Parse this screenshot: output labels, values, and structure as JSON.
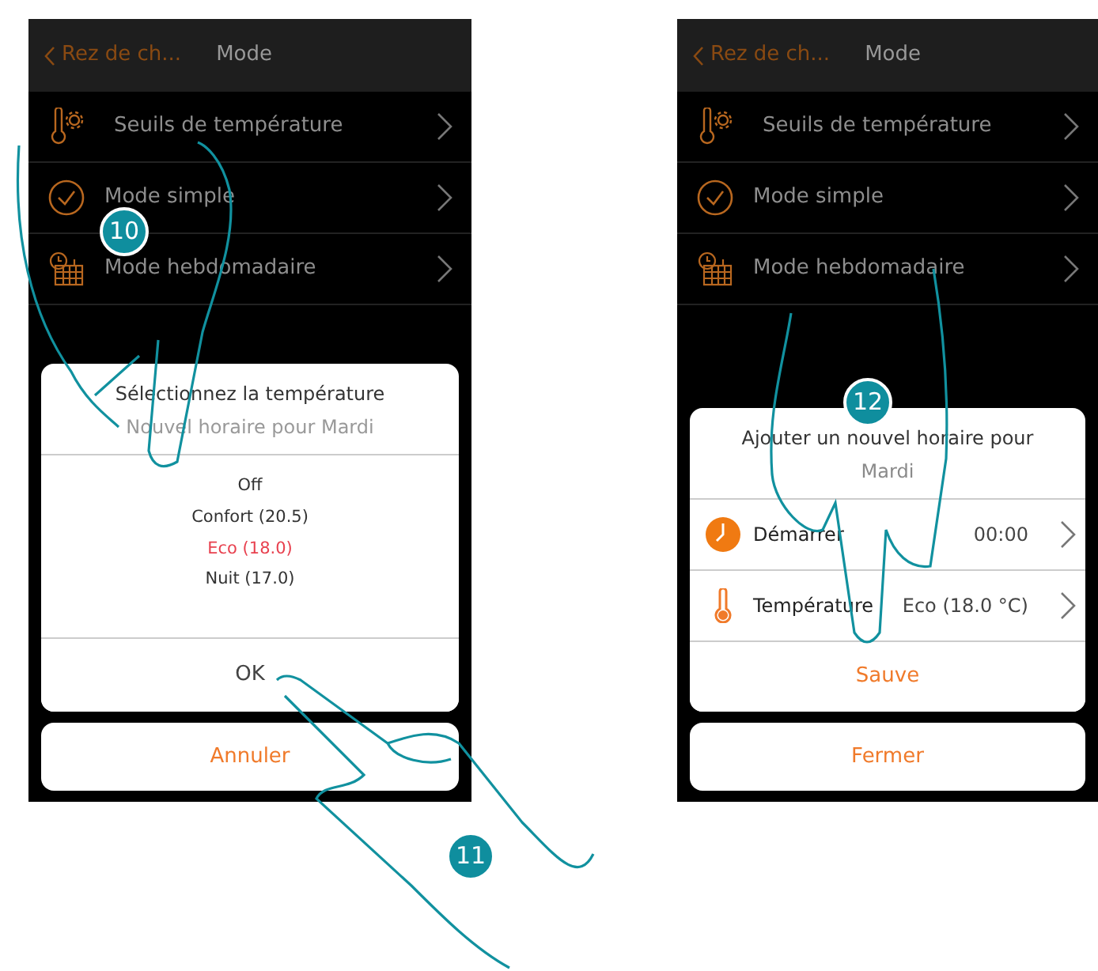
{
  "screens": [
    {
      "header": {
        "back": "Rez de ch...",
        "title": "Mode"
      },
      "menu": [
        {
          "label": "Seuils de  température"
        },
        {
          "label": "Mode simple"
        },
        {
          "label": "Mode hebdomadaire"
        }
      ],
      "dialog": {
        "kind": "picker",
        "title": "Sélectionnez la température",
        "subtitle": "Nouvel horaire pour Mardi",
        "options": [
          {
            "label": "Off",
            "selected": false
          },
          {
            "label": "Confort (20.5)",
            "selected": false
          },
          {
            "label": "Eco (18.0)",
            "selected": true
          },
          {
            "label": "Nuit (17.0)",
            "selected": false
          }
        ],
        "action": "OK"
      },
      "cancel": "Annuler"
    },
    {
      "header": {
        "back": "Rez de ch...",
        "title": "Mode"
      },
      "menu": [
        {
          "label": "Seuils de  température"
        },
        {
          "label": "Mode simple"
        },
        {
          "label": "Mode hebdomadaire"
        }
      ],
      "dialog": {
        "kind": "form",
        "title": "Ajouter un nouvel horaire pour",
        "subtitle": "Mardi",
        "fields": [
          {
            "label": "Démarrer",
            "value": "00:00"
          },
          {
            "label": "Température",
            "value": "Eco (18.0 °C)"
          }
        ],
        "action": "Sauve"
      },
      "cancel": "Fermer"
    }
  ],
  "steps": [
    "10",
    "11",
    "12"
  ]
}
